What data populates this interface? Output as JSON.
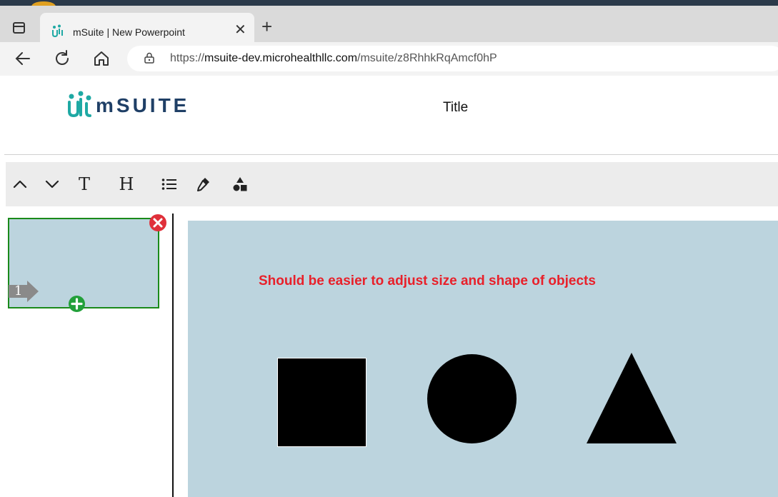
{
  "browser": {
    "tab": {
      "title": "mSuite | New Powerpoint",
      "close_label": "✕"
    },
    "new_tab_label": "+",
    "url_scheme": "https://",
    "url_host": "msuite-dev.microhealthllc.com",
    "url_path": "/msuite/z8RhhkRqAmcf0hP"
  },
  "app": {
    "logo_text": "mSUITE",
    "document_title": "Title"
  },
  "toolbar": {
    "text_tool_label": "T",
    "heading_tool_label": "H",
    "icons": [
      "chevron-up-icon",
      "chevron-down-icon",
      "text-icon",
      "heading-icon",
      "list-icon",
      "eyedropper-icon",
      "shapes-icon"
    ]
  },
  "slides": [
    {
      "number": "1"
    }
  ],
  "canvas": {
    "text": "Should be easier to adjust size and shape of objects",
    "shapes": [
      "square",
      "circle",
      "triangle"
    ]
  },
  "colors": {
    "canvas_bg": "#bcd4de",
    "text_red": "#e8202a",
    "selected_border": "#1a8a1a",
    "delete_red": "#e0303a",
    "add_green": "#22a03a",
    "logo_teal": "#1fa9a4",
    "logo_navy": "#1f3f66"
  }
}
